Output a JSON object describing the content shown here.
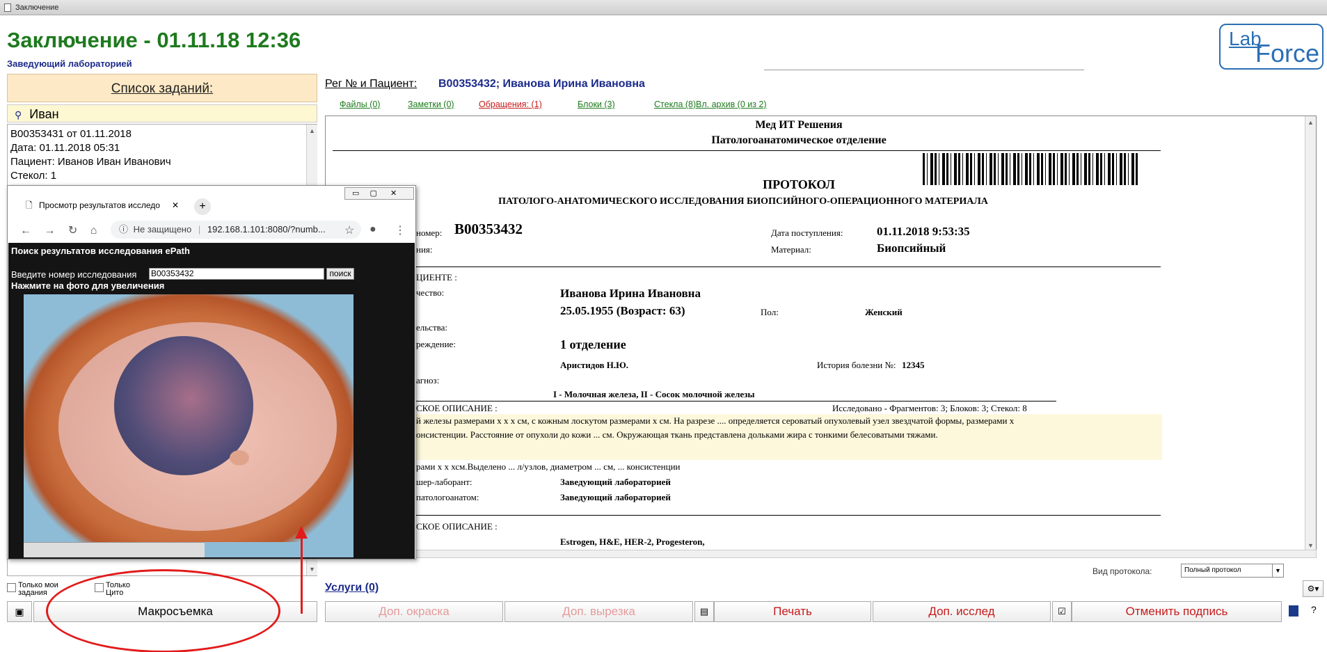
{
  "window": {
    "title": "Заключение"
  },
  "header": {
    "title": "Заключение - 01.11.18 12:36",
    "subtitle": "Заведующий лабораторией",
    "logo_part1": "Lab",
    "logo_part2": "Force"
  },
  "tasks": {
    "heading": "Список заданий:",
    "search_value": "Иван",
    "item": {
      "line1": "B00353431 от 01.11.2018",
      "line2": "Дата: 01.11.2018  05:31",
      "line3": "Пациент: Иванов Иван Иванович",
      "line4": "Стекол: 1"
    },
    "filter_my": "Только мои задания",
    "filter_cito": "Только Цито",
    "macro_button": "Макросъемка"
  },
  "reg": {
    "label": "Рег № и Пациент:",
    "value": "B00353432; Иванова Ирина Ивановна"
  },
  "tabs": [
    "Файлы (0)",
    "Заметки (0)",
    "Обращения: (1)",
    "Блоки (3)",
    "Стекла (8)",
    "Вл. архив (0 из 2)"
  ],
  "doc": {
    "org": "Мед ИТ Решения",
    "dept": "Патологоанатомическое отделение",
    "title": "ПРОТОКОЛ",
    "subtitle": "ПАТОЛОГО-АНАТОМИЧЕСКОГО ИССЛЕДОВАНИЯ БИОПСИЙНОГО-ОПЕРАЦИОННОГО МАТЕРИАЛА",
    "number_label": "номер:",
    "number": "B00353432",
    "received_label": "Дата поступления:",
    "received": "01.11.2018 9:53:35",
    "material_label": "Материал:",
    "material": "Биопсийный",
    "frag_label": "ния:",
    "patient_section": "ЦИЕНТЕ :",
    "fio_label": "чество:",
    "fio": "Иванова Ирина Ивановна",
    "birth": "25.05.1955 (Возраст: 63)",
    "sex_label": "Пол:",
    "sex": "Женский",
    "residence_label": "ельства:",
    "institution_label": "реждение:",
    "institution": "1 отделение",
    "doctor": "Аристидов Н.Ю.",
    "history_label": "История болезни №:",
    "history": "12345",
    "diag_label": "агноз:",
    "diag": "I - Молочная железа, II - Сосок молочной железы",
    "macro_section": "СКОЕ ОПИСАНИЕ :",
    "investigated": "Исследовано - Фрагментов: 3; Блоков: 3; Стекол: 8",
    "desc1": "й железы размерами х х х см, с кожным лоскутом размерами х см. На разрезе .... определяется сероватый опухолевый узел звездчатой формы, размерами х",
    "desc2": "онсистенции. Расстояние от опухоли до кожи ... см. Окружающая ткань представлена дольками жира с тонкими белесоватыми тяжами.",
    "desc3": "рами х х хсм.Выделено ... л/узлов, диаметром ... см, ... консистенции",
    "lab_label": "шер-лаборант:",
    "lab": "Заведующий лабораторией",
    "pat_label": "патологоанатом:",
    "pat": "Заведующий лабораторией",
    "micro_section": "СКОЕ ОПИСАНИЕ :",
    "stains": "Estrogen, H&E, HER-2, Progesteron,"
  },
  "popup": {
    "tab_title": "Просмотр результатов исследо",
    "url_insecure": "Не защищено",
    "url": "192.168.1.101:8080/?numb...",
    "heading": "Поиск результатов исследования ePath",
    "input_label": "Введите номер исследования",
    "input_value": "B00353432",
    "search_btn": "поиск",
    "hint": "Нажмите на фото для увеличения"
  },
  "bottom": {
    "view_label": "Вид протокола:",
    "view_value": "Полный протокол",
    "services": "Услуги (0)",
    "btn_stain": "Доп. окраска",
    "btn_cut": "Доп. вырезка",
    "btn_print": "Печать",
    "btn_research": "Доп. исслед",
    "btn_cancel": "Отменить подпись",
    "help": "?"
  }
}
